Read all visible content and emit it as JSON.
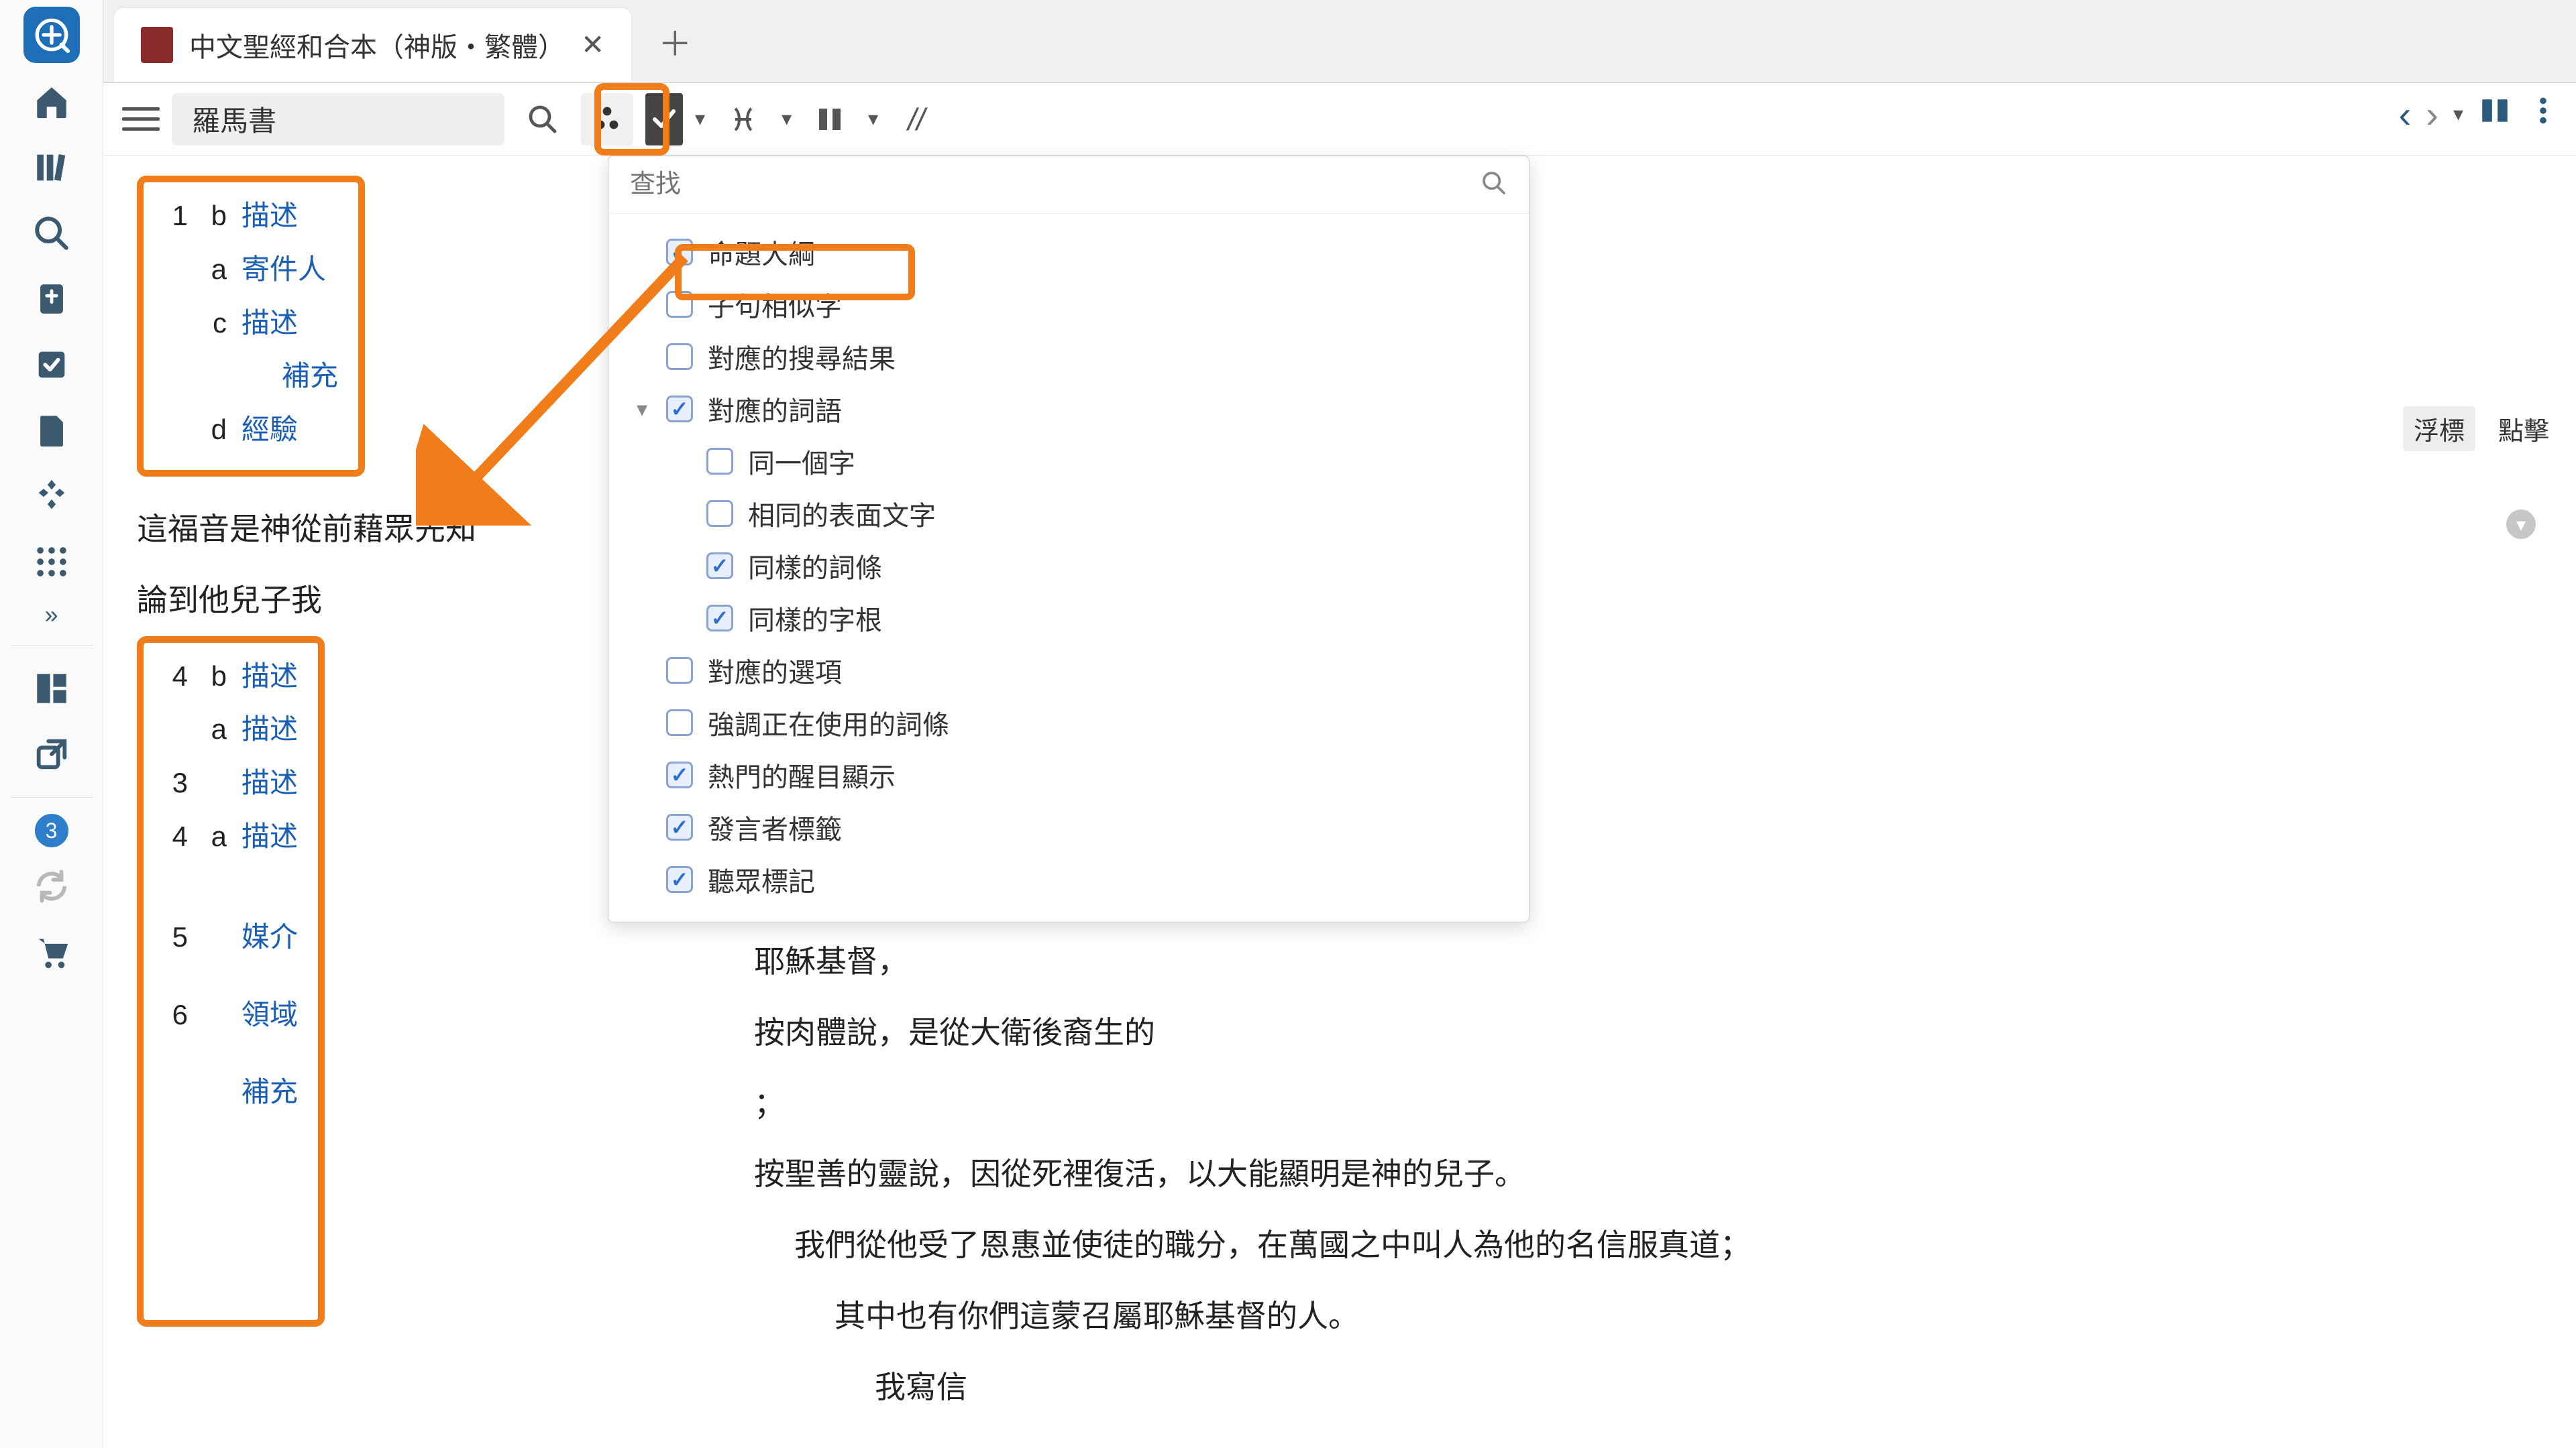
{
  "tab": {
    "title": "中文聖經和合本（神版・繁體）",
    "close_glyph": "✕",
    "add_glyph": "＋"
  },
  "toolbar": {
    "location": "羅馬書",
    "slashes": "//"
  },
  "right": {
    "prev": "‹",
    "next": "›"
  },
  "outline_top": [
    {
      "n": "1",
      "s": "b",
      "t": "描述"
    },
    {
      "n": "",
      "s": "a",
      "t": "寄件人"
    },
    {
      "n": "",
      "s": "c",
      "t": "描述"
    },
    {
      "n": "",
      "s": "",
      "t": "補充"
    },
    {
      "n": "",
      "s": "d",
      "t": "經驗"
    }
  ],
  "verses_between": [
    "這福音是神從前藉眾先知",
    "論到他兒子我"
  ],
  "outline_bottom": [
    {
      "n": "4",
      "s": "b",
      "t": "描述"
    },
    {
      "n": "",
      "s": "a",
      "t": "描述"
    },
    {
      "n": "3",
      "s": "",
      "t": "描述"
    },
    {
      "n": "4",
      "s": "a",
      "t": "描述"
    },
    {
      "n": "5",
      "s": "",
      "t": "媒介"
    },
    {
      "n": "6",
      "s": "",
      "t": "領域"
    },
    {
      "n": "",
      "s": "",
      "t": "補充"
    }
  ],
  "verses_right": [
    "耶穌基督，",
    "按肉體說，是從大衛後裔生的",
    "；",
    "按聖善的靈說，因從死裡復活，以大能顯明是神的兒子。",
    "我們從他受了恩惠並使徒的職分，在萬國之中叫人為他的名信服真道；",
    "其中也有你們這蒙召屬耶穌基督的人。",
    "我寫信"
  ],
  "popup": {
    "search_placeholder": "查找",
    "options": [
      {
        "label": "命題大綱",
        "checked": true,
        "indent": 0
      },
      {
        "label": "子句相似字",
        "checked": false,
        "indent": 0
      },
      {
        "label": "對應的搜尋結果",
        "checked": false,
        "indent": 0
      },
      {
        "label": "對應的詞語",
        "checked": true,
        "indent": 0,
        "expandable": true
      },
      {
        "label": "同一個字",
        "checked": false,
        "indent": 1
      },
      {
        "label": "相同的表面文字",
        "checked": false,
        "indent": 1
      },
      {
        "label": "同樣的詞條",
        "checked": true,
        "indent": 1
      },
      {
        "label": "同樣的字根",
        "checked": true,
        "indent": 1
      },
      {
        "label": "對應的選項",
        "checked": false,
        "indent": 0
      },
      {
        "label": "強調正在使用的詞條",
        "checked": false,
        "indent": 0
      },
      {
        "label": "熱門的醒目顯示",
        "checked": true,
        "indent": 0
      },
      {
        "label": "發言者標籤",
        "checked": true,
        "indent": 0
      },
      {
        "label": "聽眾標記",
        "checked": true,
        "indent": 0
      }
    ],
    "seg_hover": "浮標",
    "seg_click": "點擊"
  },
  "sidebar": {
    "notify_count": "3"
  }
}
